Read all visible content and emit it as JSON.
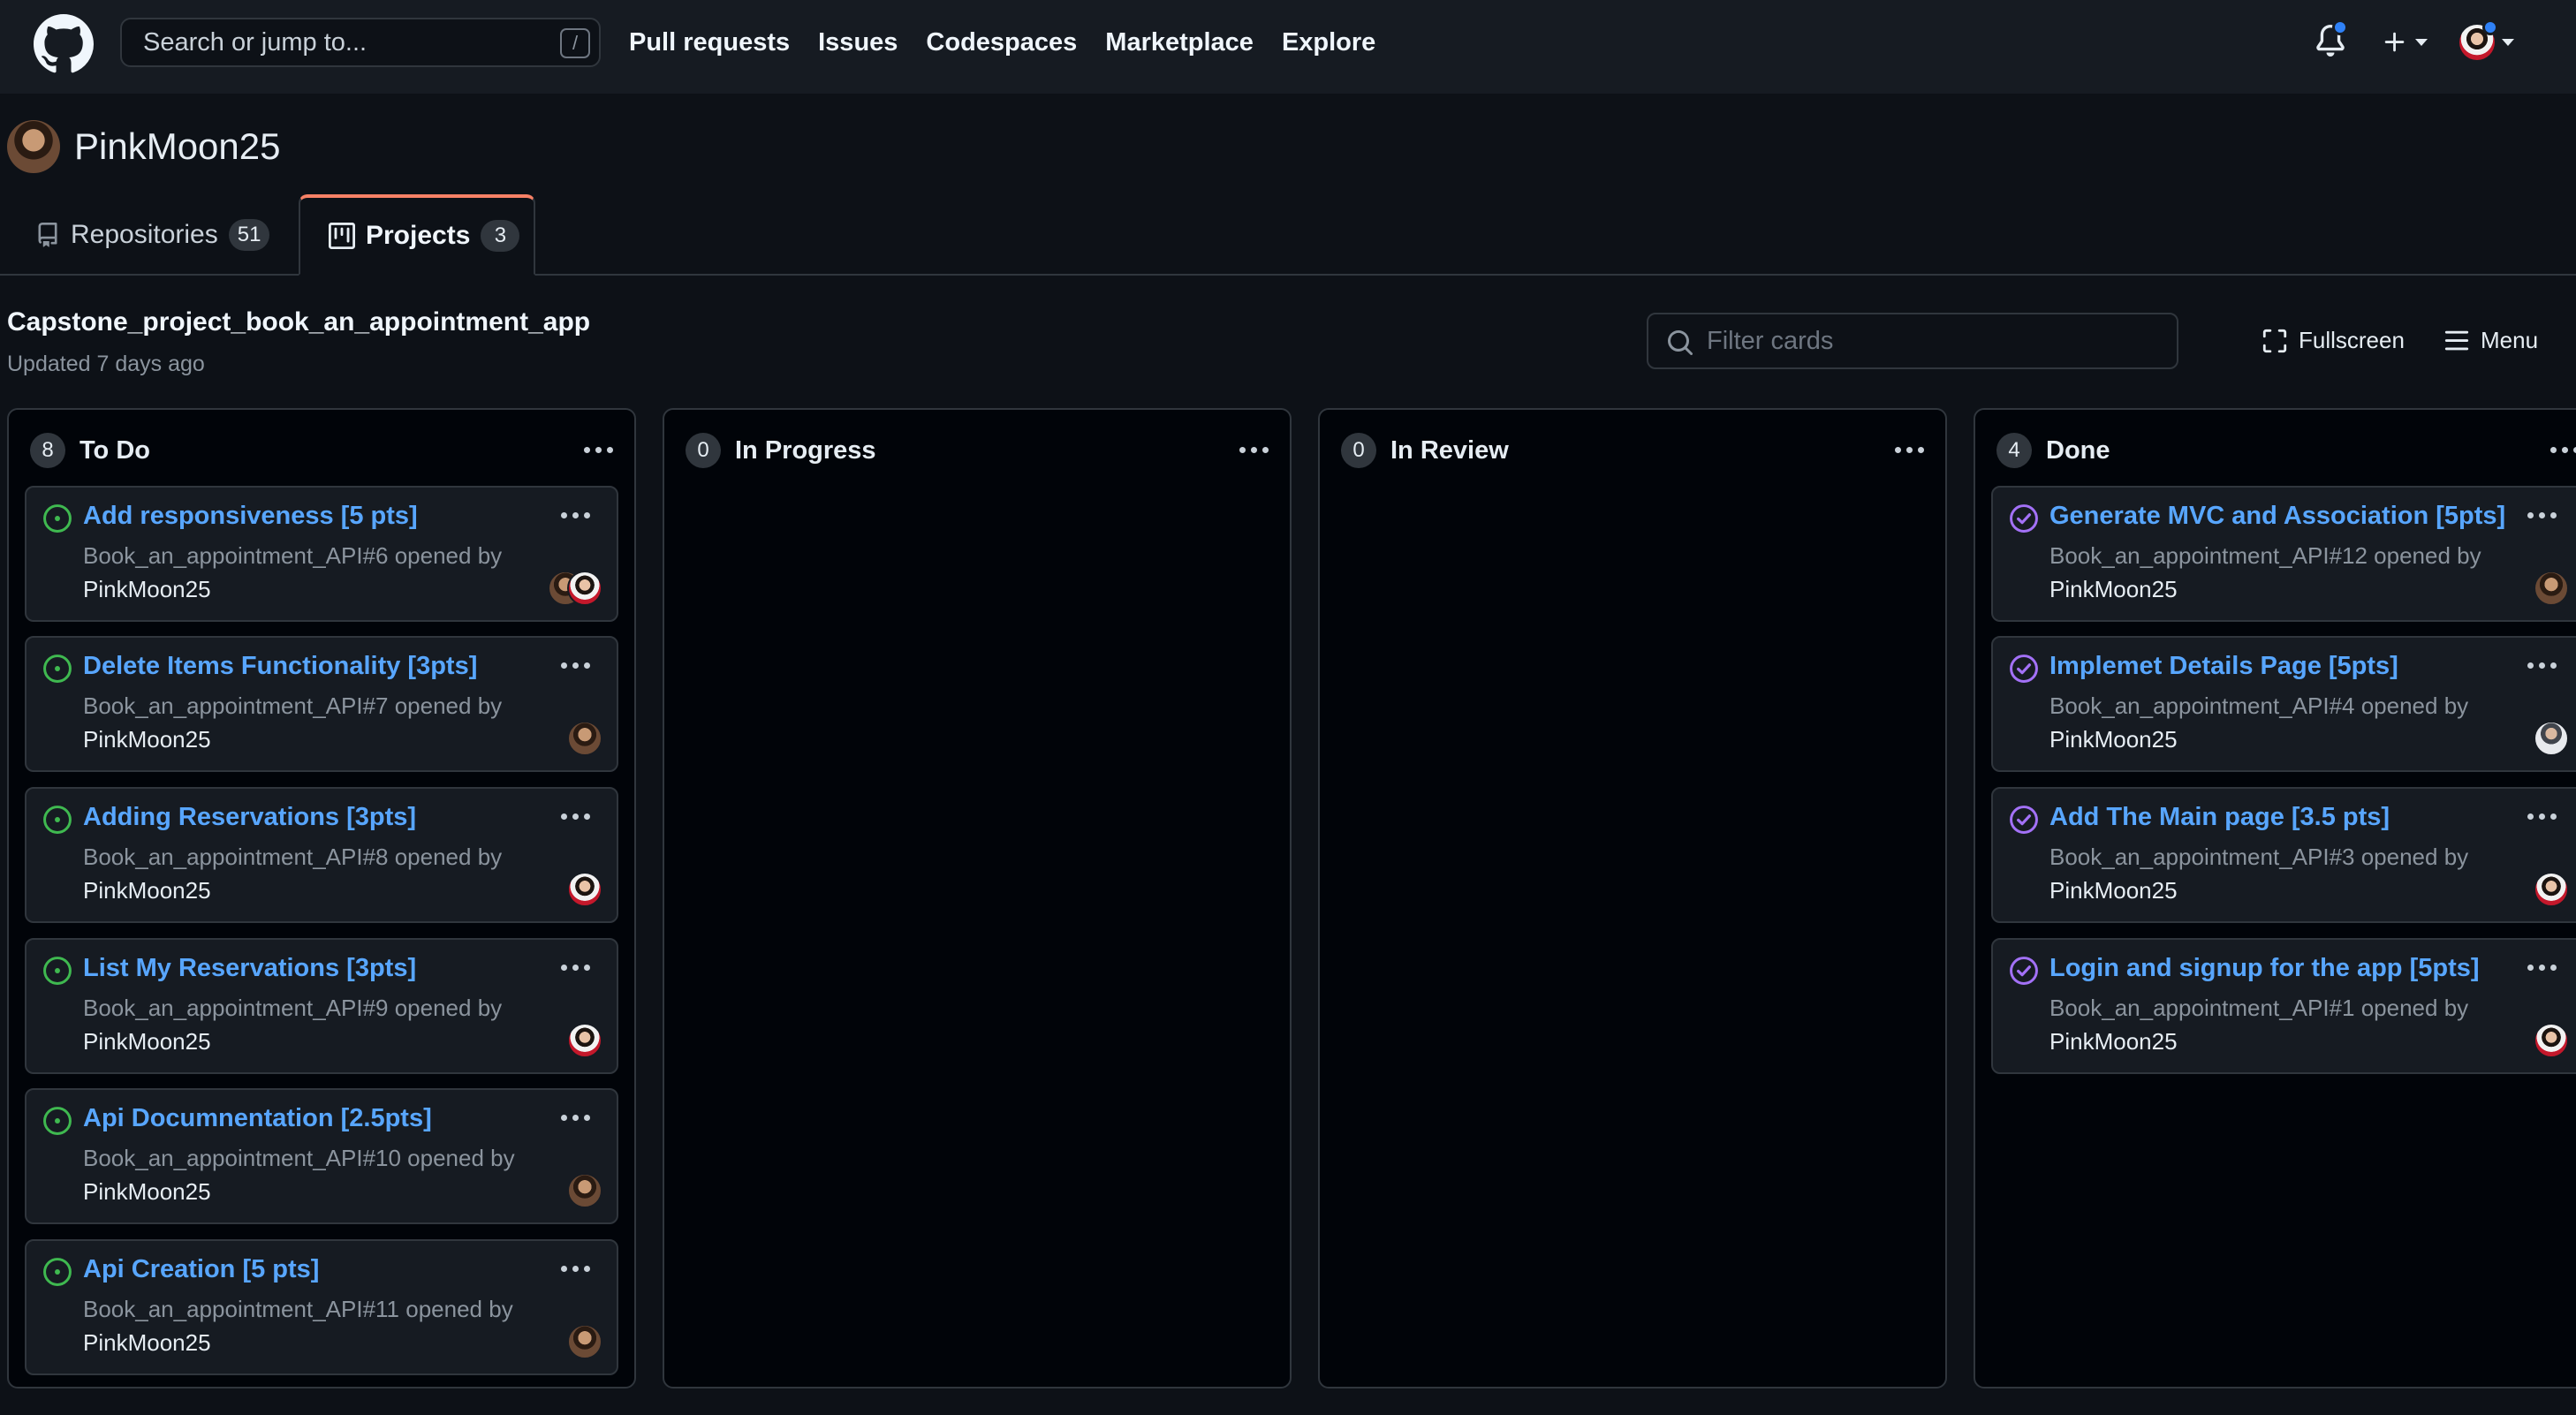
{
  "header": {
    "search_placeholder": "Search or jump to...",
    "search_shortcut": "/",
    "nav": [
      "Pull requests",
      "Issues",
      "Codespaces",
      "Marketplace",
      "Explore"
    ]
  },
  "profile": {
    "username": "PinkMoon25"
  },
  "tabs": {
    "repositories": {
      "label": "Repositories",
      "count": "51"
    },
    "projects": {
      "label": "Projects",
      "count": "3"
    }
  },
  "project": {
    "title": "Capstone_project_book_an_appointment_app",
    "updated": "Updated 7 days ago",
    "filter_placeholder": "Filter cards",
    "fullscreen_label": "Fullscreen",
    "menu_label": "Menu"
  },
  "columns": [
    {
      "name": "To Do",
      "count": "8",
      "cards": [
        {
          "title": "Add responsiveness [5 pts]",
          "ref": "Book_an_appointment_API#6 opened by",
          "author": "PinkMoon25",
          "state": "open",
          "assignees": [
            "man",
            "woman"
          ]
        },
        {
          "title": "Delete Items Functionality [3pts]",
          "ref": "Book_an_appointment_API#7 opened by",
          "author": "PinkMoon25",
          "state": "open",
          "assignees": [
            "man"
          ]
        },
        {
          "title": "Adding Reservations [3pts]",
          "ref": "Book_an_appointment_API#8 opened by",
          "author": "PinkMoon25",
          "state": "open",
          "assignees": [
            "woman"
          ]
        },
        {
          "title": "List My Reservations [3pts]",
          "ref": "Book_an_appointment_API#9 opened by",
          "author": "PinkMoon25",
          "state": "open",
          "assignees": [
            "woman"
          ]
        },
        {
          "title": "Api Documnentation [2.5pts]",
          "ref": "Book_an_appointment_API#10 opened by",
          "author": "PinkMoon25",
          "state": "open",
          "assignees": [
            "man"
          ]
        },
        {
          "title": "Api Creation [5 pts]",
          "ref": "Book_an_appointment_API#11 opened by",
          "author": "PinkMoon25",
          "state": "open",
          "assignees": [
            "man"
          ]
        }
      ]
    },
    {
      "name": "In Progress",
      "count": "0",
      "cards": []
    },
    {
      "name": "In Review",
      "count": "0",
      "cards": []
    },
    {
      "name": "Done",
      "count": "4",
      "cards": [
        {
          "title": "Generate MVC and Association [5pts]",
          "ref": "Book_an_appointment_API#12 opened by",
          "author": "PinkMoon25",
          "state": "closed",
          "assignees": [
            "man"
          ]
        },
        {
          "title": "Implemet Details Page [5pts]",
          "ref": "Book_an_appointment_API#4 opened by",
          "author": "PinkMoon25",
          "state": "closed",
          "assignees": [
            "suit"
          ]
        },
        {
          "title": "Add The Main page [3.5 pts]",
          "ref": "Book_an_appointment_API#3 opened by",
          "author": "PinkMoon25",
          "state": "closed",
          "assignees": [
            "woman"
          ]
        },
        {
          "title": "Login and signup for the app [5pts]",
          "ref": "Book_an_appointment_API#1 opened by",
          "author": "PinkMoon25",
          "state": "closed",
          "assignees": [
            "woman"
          ]
        }
      ]
    }
  ],
  "colors": {
    "open_state": "#3fb950",
    "closed_state": "#a371f7",
    "link": "#58a6ff",
    "tab_accent": "#f78166",
    "notification_dot": "#2f81f7"
  },
  "icons": [
    "github-logo-icon",
    "bell-icon",
    "plus-icon",
    "repo-icon",
    "project-icon",
    "search-icon",
    "fullscreen-icon",
    "menu-icon",
    "issue-open-icon",
    "issue-closed-icon",
    "kebab-menu-icon"
  ]
}
